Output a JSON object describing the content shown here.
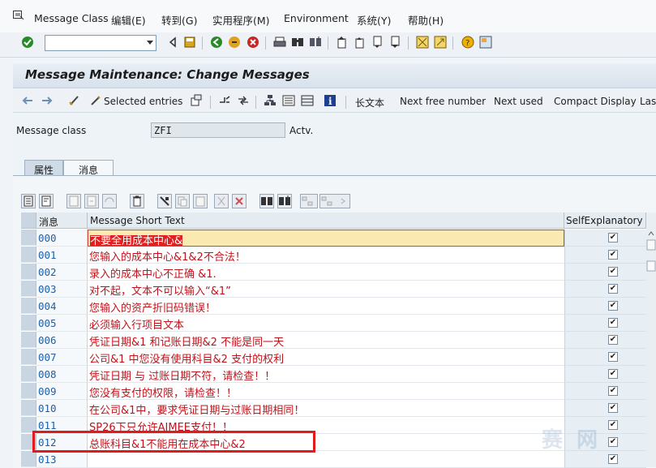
{
  "menu": {
    "items": [
      "Message Class",
      "编辑(E)",
      "转到(G)",
      "实用程序(M)",
      "Environment",
      "系统(Y)",
      "帮助(H)"
    ]
  },
  "title": "Message Maintenance: Change Messages",
  "app_toolbar": {
    "selected_entries": "Selected entries",
    "long_text": "长文本",
    "next_free_number": "Next free number",
    "next_used": "Next used",
    "compact_display": "Compact Display",
    "last": "Last"
  },
  "form": {
    "message_class_label": "Message class",
    "message_class_value": "ZFI",
    "message_class_status": "Actv."
  },
  "tabs": [
    {
      "label": "属性",
      "active": false
    },
    {
      "label": "消息",
      "active": true
    }
  ],
  "grid": {
    "columns": [
      "消息",
      "Message Short Text",
      "SelfExplanatory"
    ],
    "rows": [
      {
        "num": "000",
        "text": "不要全用成本中心&",
        "self": true
      },
      {
        "num": "001",
        "text": "您输入的成本中心&1&2不合法！",
        "self": true
      },
      {
        "num": "002",
        "text": "录入的成本中心不正确 &1.",
        "self": true
      },
      {
        "num": "003",
        "text": "对不起，文本不可以输入“&1”",
        "self": true
      },
      {
        "num": "004",
        "text": "您输入的资产折旧码错误！",
        "self": true
      },
      {
        "num": "005",
        "text": "必须输入行项目文本",
        "self": true
      },
      {
        "num": "006",
        "text": "凭证日期&1 和记账日期&2 不能是同一天",
        "self": true
      },
      {
        "num": "007",
        "text": "公司&1 中您没有使用科目&2 支付的权利",
        "self": true
      },
      {
        "num": "008",
        "text": "凭证日期 与 过账日期不符，请检查！！",
        "self": true
      },
      {
        "num": "009",
        "text": "您没有支付的权限，请检查！！",
        "self": true
      },
      {
        "num": "010",
        "text": "在公司&1中，要求凭证日期与过账日期相同！",
        "self": true
      },
      {
        "num": "011",
        "text": "SP26下只允许AIMEE支付！！",
        "self": true
      },
      {
        "num": "012",
        "text": "总账科目&1不能用在成本中心&2",
        "self": true
      },
      {
        "num": "013",
        "text": "",
        "self": true
      }
    ]
  },
  "colors": {
    "message_text": "#c0131b",
    "number_text": "#1f5fa8",
    "highlight_box": "#e01b1b"
  },
  "watermark": "赛 网"
}
